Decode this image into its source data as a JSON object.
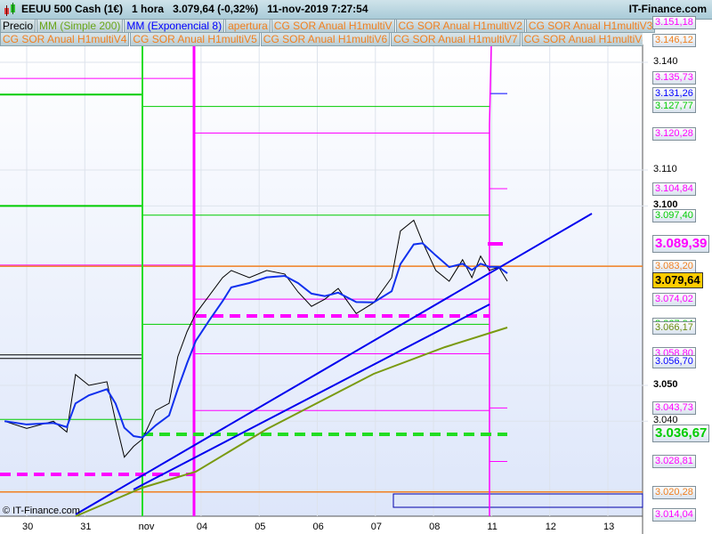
{
  "header": {
    "title": "EEUU 500 Cash (1€)   1 hora   3.079,64 (-0,32%)   11-nov-2019 7:27:54",
    "brand": "IT-Finance.com"
  },
  "legend_row1": [
    {
      "label": "Precio",
      "color": "#000000"
    },
    {
      "label": "MM (Simple 200)",
      "color": "#6aa61a"
    },
    {
      "label": "MM (Exponencial 8)",
      "color": "#0000ff"
    },
    {
      "label": "apertura",
      "color": "#f08020"
    },
    {
      "label": "CG SOR Anual H1multiV",
      "color": "#f08020"
    },
    {
      "label": "CG SOR Anual H1multiV2",
      "color": "#f08020"
    },
    {
      "label": "CG SOR Anual H1multiV3",
      "color": "#f08020"
    }
  ],
  "legend_row2": [
    {
      "label": "CG SOR Anual H1multiV4"
    },
    {
      "label": "CG SOR Anual H1multiV5"
    },
    {
      "label": "CG SOR Anual H1multiV6"
    },
    {
      "label": "CG SOR Anual H1multiV7"
    },
    {
      "label": "CG SOR Anual H1multiV8"
    },
    {
      "label": "CG SOR Anual H1m"
    }
  ],
  "copyright": "© IT-Finance.com",
  "chart_data": {
    "type": "line",
    "ylim": [
      3.006,
      3.16
    ],
    "y_ticks": [
      "3.140",
      "3.110",
      "3.100",
      "3.050",
      "3.040"
    ],
    "x_labels": [
      "30",
      "31",
      "nov",
      "04",
      "05",
      "06",
      "07",
      "08",
      "11",
      "12",
      "13"
    ],
    "price_labels": [
      {
        "text": "3.151,18",
        "value": 3.15118,
        "color": "#ff00ff"
      },
      {
        "text": "3.146,12",
        "value": 3.14612,
        "color": "#f08020"
      },
      {
        "text": "3.135,73",
        "value": 3.13573,
        "color": "#ff00ff"
      },
      {
        "text": "3.131,26",
        "value": 3.13126,
        "color": "#0000ff"
      },
      {
        "text": "3.127,77",
        "value": 3.12777,
        "color": "#00cc00"
      },
      {
        "text": "3.120,28",
        "value": 3.12028,
        "color": "#ff00ff"
      },
      {
        "text": "3.104,84",
        "value": 3.10484,
        "color": "#ff00ff"
      },
      {
        "text": "3.097,40",
        "value": 3.0974,
        "color": "#00cc00"
      },
      {
        "text": "3.089,39",
        "value": 3.08939,
        "color": "#ff00ff",
        "big": true
      },
      {
        "text": "3.083,20",
        "value": 3.0832,
        "color": "#f08020"
      },
      {
        "text": "3.079,64",
        "value": 3.07964,
        "color": "#000000",
        "current": true
      },
      {
        "text": "3.074,02",
        "value": 3.07402,
        "color": "#ff00ff"
      },
      {
        "text": "3.067,04",
        "value": 3.06704,
        "color": "#00cc00"
      },
      {
        "text": "3.066,17",
        "value": 3.06617,
        "color": "#6a8a10"
      },
      {
        "text": "3.058,80",
        "value": 3.0588,
        "color": "#ff00ff"
      },
      {
        "text": "3.056,70",
        "value": 3.0567,
        "color": "#0000ff"
      },
      {
        "text": "3.043,73",
        "value": 3.04373,
        "color": "#ff00ff"
      },
      {
        "text": "3.036,67",
        "value": 3.03667,
        "color": "#00cc00",
        "big": true
      },
      {
        "text": "3.028,81",
        "value": 3.02881,
        "color": "#ff00ff"
      },
      {
        "text": "3.020,28",
        "value": 3.02028,
        "color": "#f08020"
      },
      {
        "text": "3.014,04",
        "value": 3.01404,
        "color": "#ff00ff"
      }
    ],
    "price_series": [
      [
        -0.38,
        3.04
      ],
      [
        0,
        3.038
      ],
      [
        0.46,
        3.04
      ],
      [
        0.69,
        3.037
      ],
      [
        0.84,
        3.053
      ],
      [
        1.07,
        3.05
      ],
      [
        1.38,
        3.051
      ],
      [
        1.53,
        3.04
      ],
      [
        1.68,
        3.03
      ],
      [
        1.84,
        3.033
      ],
      [
        1.99,
        3.035
      ],
      [
        2.22,
        3.043
      ],
      [
        2.45,
        3.045
      ],
      [
        2.6,
        3.058
      ],
      [
        2.76,
        3.065
      ],
      [
        2.91,
        3.07
      ],
      [
        3.14,
        3.075
      ],
      [
        3.37,
        3.08
      ],
      [
        3.52,
        3.082
      ],
      [
        3.83,
        3.08
      ],
      [
        4.13,
        3.082
      ],
      [
        4.44,
        3.081
      ],
      [
        4.67,
        3.076
      ],
      [
        4.9,
        3.072
      ],
      [
        5.13,
        3.074
      ],
      [
        5.36,
        3.077
      ],
      [
        5.67,
        3.07
      ],
      [
        5.97,
        3.073
      ],
      [
        6.28,
        3.08
      ],
      [
        6.43,
        3.093
      ],
      [
        6.66,
        3.096
      ],
      [
        6.81,
        3.09
      ],
      [
        7.04,
        3.082
      ],
      [
        7.27,
        3.079
      ],
      [
        7.5,
        3.085
      ],
      [
        7.66,
        3.08
      ],
      [
        7.81,
        3.086
      ],
      [
        7.96,
        3.082
      ],
      [
        8.12,
        3.083
      ],
      [
        8.27,
        3.079
      ]
    ]
  }
}
